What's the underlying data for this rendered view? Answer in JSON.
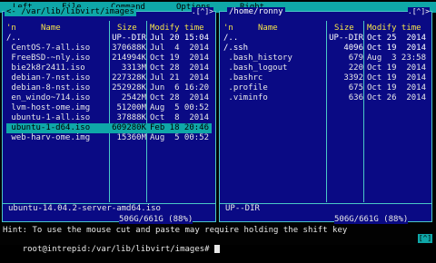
{
  "menu": {
    "items": [
      "Left",
      "File",
      "Command",
      "Options",
      "Right"
    ]
  },
  "left_panel": {
    "path": "<- /var/lib/libvirt/images",
    "corner": ".[^]>",
    "headers": {
      "n": "'n",
      "name": "Name",
      "size": "Size",
      "modify": "Modify time"
    },
    "rows": [
      {
        "name": "/..",
        "size": "UP--DIR",
        "date": "Jul 20 15:04"
      },
      {
        "name": " CentOS-7-all.iso",
        "size": "370688K",
        "date": "Jul  4  2014"
      },
      {
        "name": " FreeBSD-~nly.iso",
        "size": "214994K",
        "date": "Oct 19  2014"
      },
      {
        "name": " bie2k8r2411.iso",
        "size": "3313M",
        "date": "Oct 28  2014"
      },
      {
        "name": " debian-7-nst.iso",
        "size": "227328K",
        "date": "Jul 21  2014"
      },
      {
        "name": " debian-8-nst.iso",
        "size": "252928K",
        "date": "Jun  6 16:20"
      },
      {
        "name": " en_windo~714.iso",
        "size": "2542M",
        "date": "Oct 28  2014"
      },
      {
        "name": " lvm-host-ome.img",
        "size": "51200M",
        "date": "Aug  5 00:52"
      },
      {
        "name": " ubuntu-1-all.iso",
        "size": "37888K",
        "date": "Oct  8  2014"
      },
      {
        "name": " ubuntu-1-d64.iso",
        "size": "609280K",
        "date": "Feb 18 20:46"
      },
      {
        "name": " web-harv-ome.img",
        "size": "15360M",
        "date": "Aug  5 00:52"
      }
    ],
    "status": "ubuntu-14.04.2-server-amd64.iso",
    "disk": "506G/661G (88%)"
  },
  "right_panel": {
    "path": "/home/ronny",
    "corner": ".[^]>",
    "headers": {
      "n": "'n",
      "name": "Name",
      "size": "Size",
      "modify": "Modify time"
    },
    "rows": [
      {
        "name": "/..",
        "size": "UP--DIR",
        "date": "Oct 25  2014"
      },
      {
        "name": "/.ssh",
        "size": "4096",
        "date": "Oct 19  2014"
      },
      {
        "name": " .bash_history",
        "size": "679",
        "date": "Aug  3 23:58"
      },
      {
        "name": " .bash_logout",
        "size": "220",
        "date": "Oct 19  2014"
      },
      {
        "name": " .bashrc",
        "size": "3392",
        "date": "Oct 19  2014"
      },
      {
        "name": " .profile",
        "size": "675",
        "date": "Oct 19  2014"
      },
      {
        "name": " .viminfo",
        "size": "636",
        "date": "Oct 26  2014"
      }
    ],
    "status": "UP--DIR",
    "disk": "506G/661G (88%)"
  },
  "hint": "Hint: To use the mouse cut and paste may require holding the shift key",
  "prompt": "root@intrepid:/var/lib/libvirt/images# ",
  "br_indicator": "[^]",
  "colors": {
    "panel_bg": "#0a0a84",
    "accent": "#0fa7a8",
    "header": "#f6e44a",
    "text": "#e8e8e8"
  }
}
